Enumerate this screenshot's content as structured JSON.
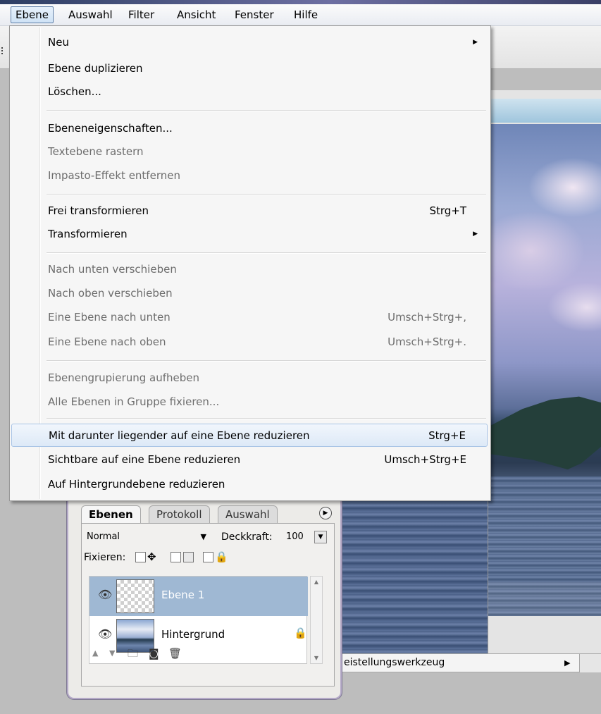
{
  "menubar": {
    "items": [
      {
        "label": "Ebene"
      },
      {
        "label": "Auswahl"
      },
      {
        "label": "Filter"
      },
      {
        "label": "Ansicht"
      },
      {
        "label": "Fenster"
      },
      {
        "label": "Hilfe"
      }
    ],
    "active": "Ebene"
  },
  "layer_menu": {
    "items": [
      {
        "label": "Neu",
        "shortcut": "",
        "submenu": true,
        "disabled": false
      },
      {
        "label": "Ebene duplizieren",
        "shortcut": "",
        "submenu": false,
        "disabled": false
      },
      {
        "label": "Löschen...",
        "shortcut": "",
        "submenu": false,
        "disabled": false
      },
      {
        "label": "Ebeneneigenschaften...",
        "shortcut": "",
        "submenu": false,
        "disabled": false
      },
      {
        "label": "Textebene rastern",
        "shortcut": "",
        "submenu": false,
        "disabled": true
      },
      {
        "label": "Impasto-Effekt entfernen",
        "shortcut": "",
        "submenu": false,
        "disabled": true
      },
      {
        "label": "Frei transformieren",
        "shortcut": "Strg+T",
        "submenu": false,
        "disabled": false
      },
      {
        "label": "Transformieren",
        "shortcut": "",
        "submenu": true,
        "disabled": false
      },
      {
        "label": "Nach unten verschieben",
        "shortcut": "",
        "submenu": false,
        "disabled": true
      },
      {
        "label": "Nach oben verschieben",
        "shortcut": "",
        "submenu": false,
        "disabled": true
      },
      {
        "label": "Eine Ebene nach unten",
        "shortcut": "Umsch+Strg+,",
        "submenu": false,
        "disabled": true
      },
      {
        "label": "Eine Ebene nach oben",
        "shortcut": "Umsch+Strg+.",
        "submenu": false,
        "disabled": true
      },
      {
        "label": "Ebenengrupierung aufheben",
        "shortcut": "",
        "submenu": false,
        "disabled": true
      },
      {
        "label": "Alle Ebenen in Gruppe fixieren...",
        "shortcut": "",
        "submenu": false,
        "disabled": true
      },
      {
        "label": "Mit darunter liegender auf eine Ebene reduzieren",
        "shortcut": "Strg+E",
        "submenu": false,
        "disabled": false,
        "highlighted": true
      },
      {
        "label": "Sichtbare auf eine Ebene reduzieren",
        "shortcut": "Umsch+Strg+E",
        "submenu": false,
        "disabled": false
      },
      {
        "label": "Auf Hintergrundebene reduzieren",
        "shortcut": "",
        "submenu": false,
        "disabled": false
      }
    ]
  },
  "layers_palette": {
    "tabs": [
      "Ebenen",
      "Protokoll",
      "Auswahl"
    ],
    "active_tab": "Ebenen",
    "blend_mode": "Normal",
    "opacity_label": "Deckkraft:",
    "opacity_value": "100",
    "lock_label": "Fixieren:",
    "layers": [
      {
        "name": "Ebene 1",
        "selected": true,
        "visible": true,
        "locked": false
      },
      {
        "name": "Hintergrund",
        "selected": false,
        "visible": true,
        "locked": true
      }
    ]
  },
  "status_bar": {
    "text": "eistellungswerkzeug"
  },
  "icons": {
    "submenu_arrow": "submenu-arrow-icon",
    "eye": "eye-icon",
    "lock": "lock-icon",
    "move": "move-icon",
    "new_folder": "new-folder-icon",
    "new_layer": "new-layer-icon",
    "trash": "trash-icon"
  },
  "colors": {
    "menu_highlight": "#dde9f7",
    "layer_selected": "#9fb8d3",
    "disabled_text": "#6d6d6d"
  }
}
